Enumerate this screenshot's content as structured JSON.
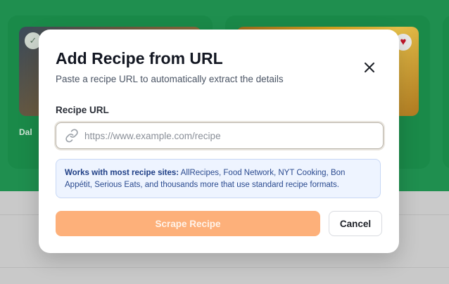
{
  "background": {
    "cards": [
      {
        "title": "Dal",
        "badge_icon": "check-icon"
      },
      {
        "title": "",
        "badge_icon": "heart-icon"
      }
    ]
  },
  "modal": {
    "title": "Add Recipe from URL",
    "subtitle": "Paste a recipe URL to automatically extract the details",
    "close_icon": "close-icon",
    "field_label": "Recipe URL",
    "url_input": {
      "value": "",
      "placeholder": "https://www.example.com/recipe",
      "icon": "link-icon"
    },
    "info": {
      "lead": "Works with most recipe sites:",
      "text": " AllRecipes, Food Network, NYT Cooking, Bon Appétit, Serious Eats, and thousands more that use standard recipe formats."
    },
    "primary_button": "Scrape Recipe",
    "cancel_button": "Cancel"
  },
  "colors": {
    "header_green": "#1f8f4f",
    "primary_button_disabled": "#fdb07a",
    "info_bg": "#eef4ff",
    "info_text": "#2a4a8f"
  }
}
